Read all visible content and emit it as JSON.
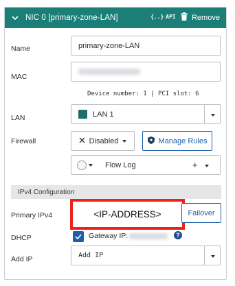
{
  "nic": {
    "title": "NIC 0 [primary-zone-LAN]",
    "api_label": "API",
    "remove_label": "Remove"
  },
  "fields": {
    "name_label": "Name",
    "name_value": "primary-zone-LAN",
    "mac_label": "MAC",
    "device_info": "Device number: 1 | PCI slot: 6",
    "lan_label": "LAN",
    "lan_value": "LAN 1",
    "firewall_label": "Firewall",
    "firewall_value": "Disabled",
    "manage_rules_label": "Manage Rules",
    "flow_log_label": "Flow Log",
    "flow_log_add": "+"
  },
  "ipv4": {
    "section_title": "IPv4 Configuration",
    "primary_label": "Primary IPv4",
    "primary_value": "<IP-ADDRESS>",
    "failover_label": "Failover",
    "dhcp_label": "DHCP",
    "dhcp_checked": true,
    "gateway_label": "Gateway IP:",
    "help_glyph": "?",
    "add_ip_label": "Add IP",
    "add_ip_placeholder": "Add IP"
  },
  "colors": {
    "header_bg": "#1b7f78",
    "primary_blue": "#1d5fa8",
    "highlight_red": "#e8231c"
  }
}
